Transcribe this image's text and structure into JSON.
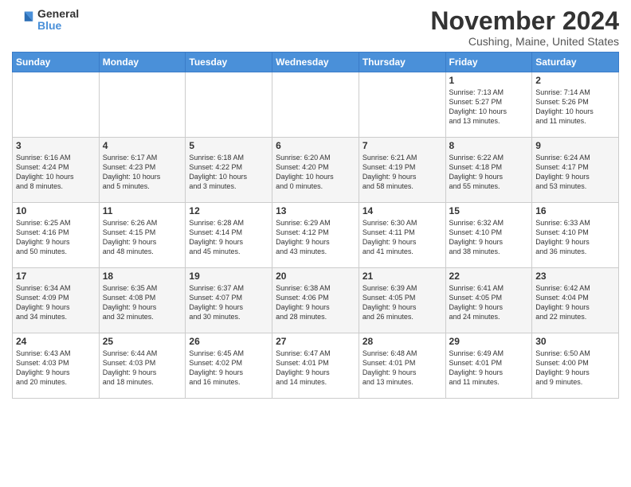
{
  "logo": {
    "general": "General",
    "blue": "Blue"
  },
  "title": "November 2024",
  "location": "Cushing, Maine, United States",
  "days_of_week": [
    "Sunday",
    "Monday",
    "Tuesday",
    "Wednesday",
    "Thursday",
    "Friday",
    "Saturday"
  ],
  "weeks": [
    [
      {
        "day": "",
        "info": ""
      },
      {
        "day": "",
        "info": ""
      },
      {
        "day": "",
        "info": ""
      },
      {
        "day": "",
        "info": ""
      },
      {
        "day": "",
        "info": ""
      },
      {
        "day": "1",
        "info": "Sunrise: 7:13 AM\nSunset: 5:27 PM\nDaylight: 10 hours\nand 13 minutes."
      },
      {
        "day": "2",
        "info": "Sunrise: 7:14 AM\nSunset: 5:26 PM\nDaylight: 10 hours\nand 11 minutes."
      }
    ],
    [
      {
        "day": "3",
        "info": "Sunrise: 6:16 AM\nSunset: 4:24 PM\nDaylight: 10 hours\nand 8 minutes."
      },
      {
        "day": "4",
        "info": "Sunrise: 6:17 AM\nSunset: 4:23 PM\nDaylight: 10 hours\nand 5 minutes."
      },
      {
        "day": "5",
        "info": "Sunrise: 6:18 AM\nSunset: 4:22 PM\nDaylight: 10 hours\nand 3 minutes."
      },
      {
        "day": "6",
        "info": "Sunrise: 6:20 AM\nSunset: 4:20 PM\nDaylight: 10 hours\nand 0 minutes."
      },
      {
        "day": "7",
        "info": "Sunrise: 6:21 AM\nSunset: 4:19 PM\nDaylight: 9 hours\nand 58 minutes."
      },
      {
        "day": "8",
        "info": "Sunrise: 6:22 AM\nSunset: 4:18 PM\nDaylight: 9 hours\nand 55 minutes."
      },
      {
        "day": "9",
        "info": "Sunrise: 6:24 AM\nSunset: 4:17 PM\nDaylight: 9 hours\nand 53 minutes."
      }
    ],
    [
      {
        "day": "10",
        "info": "Sunrise: 6:25 AM\nSunset: 4:16 PM\nDaylight: 9 hours\nand 50 minutes."
      },
      {
        "day": "11",
        "info": "Sunrise: 6:26 AM\nSunset: 4:15 PM\nDaylight: 9 hours\nand 48 minutes."
      },
      {
        "day": "12",
        "info": "Sunrise: 6:28 AM\nSunset: 4:14 PM\nDaylight: 9 hours\nand 45 minutes."
      },
      {
        "day": "13",
        "info": "Sunrise: 6:29 AM\nSunset: 4:12 PM\nDaylight: 9 hours\nand 43 minutes."
      },
      {
        "day": "14",
        "info": "Sunrise: 6:30 AM\nSunset: 4:11 PM\nDaylight: 9 hours\nand 41 minutes."
      },
      {
        "day": "15",
        "info": "Sunrise: 6:32 AM\nSunset: 4:10 PM\nDaylight: 9 hours\nand 38 minutes."
      },
      {
        "day": "16",
        "info": "Sunrise: 6:33 AM\nSunset: 4:10 PM\nDaylight: 9 hours\nand 36 minutes."
      }
    ],
    [
      {
        "day": "17",
        "info": "Sunrise: 6:34 AM\nSunset: 4:09 PM\nDaylight: 9 hours\nand 34 minutes."
      },
      {
        "day": "18",
        "info": "Sunrise: 6:35 AM\nSunset: 4:08 PM\nDaylight: 9 hours\nand 32 minutes."
      },
      {
        "day": "19",
        "info": "Sunrise: 6:37 AM\nSunset: 4:07 PM\nDaylight: 9 hours\nand 30 minutes."
      },
      {
        "day": "20",
        "info": "Sunrise: 6:38 AM\nSunset: 4:06 PM\nDaylight: 9 hours\nand 28 minutes."
      },
      {
        "day": "21",
        "info": "Sunrise: 6:39 AM\nSunset: 4:05 PM\nDaylight: 9 hours\nand 26 minutes."
      },
      {
        "day": "22",
        "info": "Sunrise: 6:41 AM\nSunset: 4:05 PM\nDaylight: 9 hours\nand 24 minutes."
      },
      {
        "day": "23",
        "info": "Sunrise: 6:42 AM\nSunset: 4:04 PM\nDaylight: 9 hours\nand 22 minutes."
      }
    ],
    [
      {
        "day": "24",
        "info": "Sunrise: 6:43 AM\nSunset: 4:03 PM\nDaylight: 9 hours\nand 20 minutes."
      },
      {
        "day": "25",
        "info": "Sunrise: 6:44 AM\nSunset: 4:03 PM\nDaylight: 9 hours\nand 18 minutes."
      },
      {
        "day": "26",
        "info": "Sunrise: 6:45 AM\nSunset: 4:02 PM\nDaylight: 9 hours\nand 16 minutes."
      },
      {
        "day": "27",
        "info": "Sunrise: 6:47 AM\nSunset: 4:01 PM\nDaylight: 9 hours\nand 14 minutes."
      },
      {
        "day": "28",
        "info": "Sunrise: 6:48 AM\nSunset: 4:01 PM\nDaylight: 9 hours\nand 13 minutes."
      },
      {
        "day": "29",
        "info": "Sunrise: 6:49 AM\nSunset: 4:01 PM\nDaylight: 9 hours\nand 11 minutes."
      },
      {
        "day": "30",
        "info": "Sunrise: 6:50 AM\nSunset: 4:00 PM\nDaylight: 9 hours\nand 9 minutes."
      }
    ]
  ]
}
